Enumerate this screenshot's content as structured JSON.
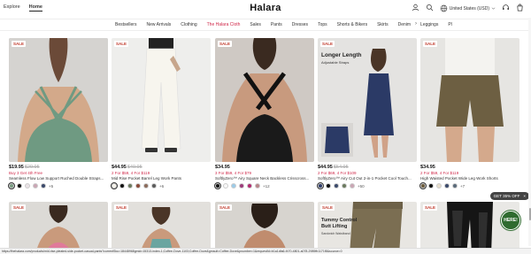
{
  "header": {
    "tabs": [
      {
        "label": "Explore",
        "active": false
      },
      {
        "label": "Home",
        "active": true
      }
    ],
    "logo": "Halara",
    "currency": "United States (USD)"
  },
  "nav": {
    "items": [
      "Bestsellers",
      "New Arrivals",
      "Clothing",
      "The Halara Cloth",
      "Sales",
      "Pants",
      "Dresses",
      "Tops",
      "Shorts & Bikers",
      "Skirts",
      "Denim",
      "Leggings",
      "Pl"
    ],
    "accent_item": "The Halara Cloth"
  },
  "products": [
    {
      "badge": "SALE",
      "price": "$19.95",
      "old_price": "$29.95",
      "promo": "Buy 3 Get 4th Free",
      "title": "Seamless Flow Low Support Ruched Double Straps...",
      "swatches": [
        "#7a9c82",
        "#111111",
        "#e9e2e6",
        "#caa6b4",
        "#3b4a6b"
      ],
      "more": "+5"
    },
    {
      "badge": "SALE",
      "price": "$44.95",
      "old_price": "$49.95",
      "promo": "2 For $59, 4 For $119",
      "title": "Mid Rise Pocket Barrel Leg Work Pants",
      "swatches": [
        "#f5f2ea",
        "#111111",
        "#6b7a5e",
        "#8a4a3a",
        "#8b6b5b",
        "#5b5b5b"
      ],
      "more": "+6"
    },
    {
      "badge": "SALE",
      "price": "$34.95",
      "old_price": "",
      "promo": "3 For $59, 4 For $79",
      "title": "SoftlyZero™ Airy Square Neck Backless Crisscross...",
      "swatches": [
        "#111111",
        "#f7f7f7",
        "#9ccbe8",
        "#9c3b7a",
        "#b22a70",
        "#b9868a"
      ],
      "more": "+12"
    },
    {
      "badge": "SALE",
      "price": "$44.95",
      "old_price": "$54.95",
      "promo": "2 For $69, 4 For $109",
      "title": "SoftlyZero™ Airy Cut Out 2-in-1 Pocket Cool Touch...",
      "swatches": [
        "#2f3d6b",
        "#111111",
        "#3b4a6b",
        "#6b7a5e",
        "#caa6b4"
      ],
      "more": "+50"
    },
    {
      "badge": "SALE",
      "price": "$34.95",
      "old_price": "",
      "promo": "2 For $59, 4 For $119",
      "title": "High Waisted Pocket Wide Leg Work Shorts",
      "swatches": [
        "#6b5a3a",
        "#111111",
        "#e6ddcc",
        "#3b4a6b",
        "#5b6b7a"
      ],
      "more": "+7"
    }
  ],
  "lower_badges": [
    "SALE",
    "SALE",
    "SALE",
    "SALE",
    "SALE"
  ],
  "overlay_texts": {
    "longer_length": "Longer Length",
    "adjustable_straps": "Adjustable Straps",
    "tummy_control": "Tummy Control Butt Lifting",
    "tummy_sub": "Sandwich Waistband"
  },
  "promo_pill": {
    "label": "GET 35% OFF",
    "close": "×"
  },
  "help_badge": "HERE!",
  "status_url": "https://thehalara.com/products/mid-rise-pleated-side-pocket-casual-pants?currentSku=18448968gmid=15313-index-1;Coffee-Dove-1103;Coffee-Dove&gmsuit=Coffee-Dove&pnumber=1&requestId=b1a1dfa6-f470-4801-a078-2989fb1171f8&source=0"
}
